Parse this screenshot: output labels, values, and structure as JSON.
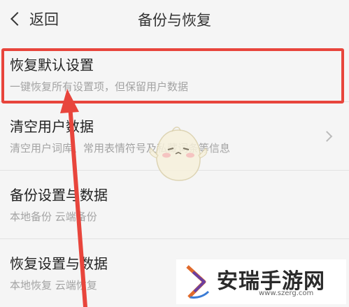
{
  "header": {
    "back_label": "返回",
    "title": "备份与恢复"
  },
  "items": [
    {
      "label": "恢复默认设置",
      "desc": "一键恢复所有设置项，但保留用户数据"
    },
    {
      "label": "清空用户数据",
      "desc": "清空用户词库、常用表情符号及私藏词条等信息"
    },
    {
      "label": "备份设置与数据",
      "desc": "本地备份 云端备份"
    },
    {
      "label": "恢复设置与数据",
      "desc": "本地恢复 云端恢复"
    }
  ],
  "watermark": {
    "name": "安瑞手游网",
    "url": "www.szerg.com"
  },
  "colors": {
    "highlight": "#e8453c",
    "background": "#f5f5f5"
  },
  "icons": {
    "back": "chevron-left-icon",
    "row_chevron": "chevron-right-icon"
  }
}
